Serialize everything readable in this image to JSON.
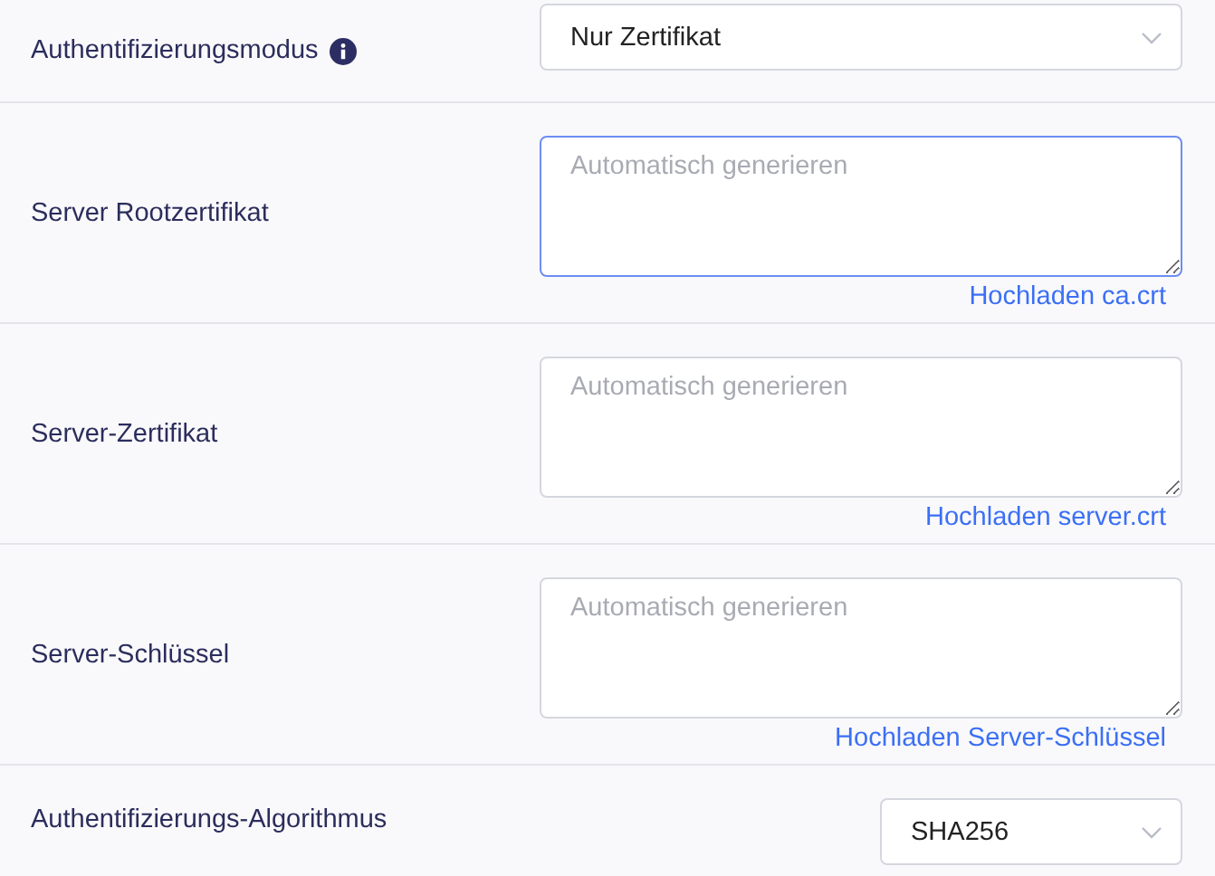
{
  "rows": [
    {
      "label": "Authentifizierungsmodus",
      "info": true,
      "field": {
        "kind": "select",
        "value": "Nur Zertifikat"
      }
    },
    {
      "label": "Server Rootzertifikat",
      "info": false,
      "field": {
        "kind": "textarea",
        "placeholder": "Automatisch generieren",
        "focused": true
      },
      "link": "Hochladen ca.crt"
    },
    {
      "label": "Server-Zertifikat",
      "info": false,
      "field": {
        "kind": "textarea",
        "placeholder": "Automatisch generieren",
        "focused": false
      },
      "link": "Hochladen server.crt"
    },
    {
      "label": "Server-Schlüssel",
      "info": false,
      "field": {
        "kind": "textarea",
        "placeholder": "Automatisch generieren",
        "focused": false
      },
      "link": "Hochladen Server-Schlüssel"
    },
    {
      "label": "Authentifizierungs-Algorithmus",
      "info": false,
      "field": {
        "kind": "miniselect",
        "value": "SHA256"
      }
    }
  ]
}
